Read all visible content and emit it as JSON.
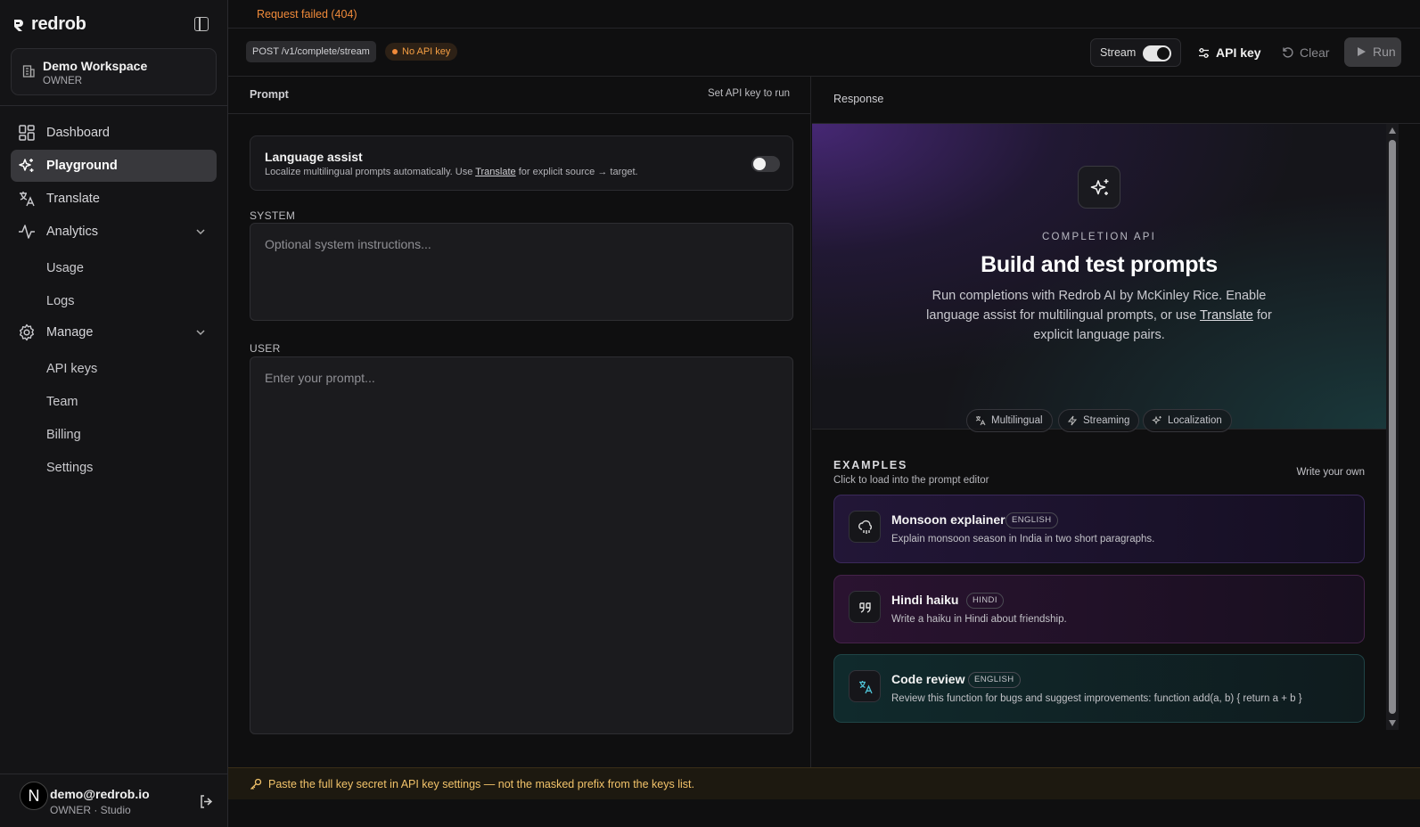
{
  "brand": {
    "name": "redrob"
  },
  "workspace": {
    "name": "Demo Workspace",
    "role": "OWNER"
  },
  "nav": {
    "dashboard": "Dashboard",
    "playground": "Playground",
    "translate": "Translate",
    "analytics": "Analytics",
    "usage": "Usage",
    "logs": "Logs",
    "manage": "Manage",
    "api_keys": "API keys",
    "team": "Team",
    "billing": "Billing",
    "settings": "Settings"
  },
  "user": {
    "initial": "N",
    "email": "demo@redrob.io",
    "subtitle": "OWNER · Studio"
  },
  "error": {
    "text": "Request failed (404)"
  },
  "toolbar": {
    "endpoint": "POST /v1/complete/stream",
    "no_key": "No API key",
    "stream_label": "Stream",
    "stream_on": true,
    "api_key_label": "API key",
    "clear_label": "Clear",
    "run_label": "Run"
  },
  "prompt": {
    "title": "Prompt",
    "hint": "Set API key to run",
    "lang_title": "Language assist",
    "lang_desc_pre": "Localize multilingual prompts automatically. Use ",
    "lang_desc_link": "Translate",
    "lang_desc_post": " for explicit source → target.",
    "lang_on": false,
    "system_label": "SYSTEM",
    "system_placeholder": "Optional system instructions...",
    "user_label": "USER",
    "user_placeholder": "Enter your prompt..."
  },
  "response": {
    "title": "Response",
    "caption": "COMPLETION API",
    "heading": "Build and test prompts",
    "desc_pre": "Run completions with Redrob AI by McKinley Rice. Enable language assist for multilingual prompts, or use ",
    "desc_link": "Translate",
    "desc_post": " for explicit language pairs.",
    "chips": [
      "Multilingual",
      "Streaming",
      "Localization"
    ]
  },
  "examples": {
    "title": "EXAMPLES",
    "subtitle": "Click to load into the prompt editor",
    "write_own": "Write your own",
    "items": [
      {
        "name": "Monsoon explainer",
        "tag": "ENGLISH",
        "desc": "Explain monsoon season in India in two short paragraphs.",
        "icon": "cloud-rain-icon"
      },
      {
        "name": "Hindi haiku",
        "tag": "HINDI",
        "desc": "Write a haiku in Hindi about friendship.",
        "icon": "quote-icon"
      },
      {
        "name": "Code review",
        "tag": "ENGLISH",
        "desc": "Review this function for bugs and suggest improvements: function add(a, b) { return a + b }",
        "icon": "languages-icon"
      }
    ]
  },
  "hint": {
    "text": "Paste the full key secret in API key settings — not the masked prefix from the keys list."
  },
  "colors": {
    "accent_orange": "#f08a3a",
    "hint_yellow": "#f2c36a",
    "bg": "#0f0f10",
    "sidebar_bg": "#141416"
  }
}
